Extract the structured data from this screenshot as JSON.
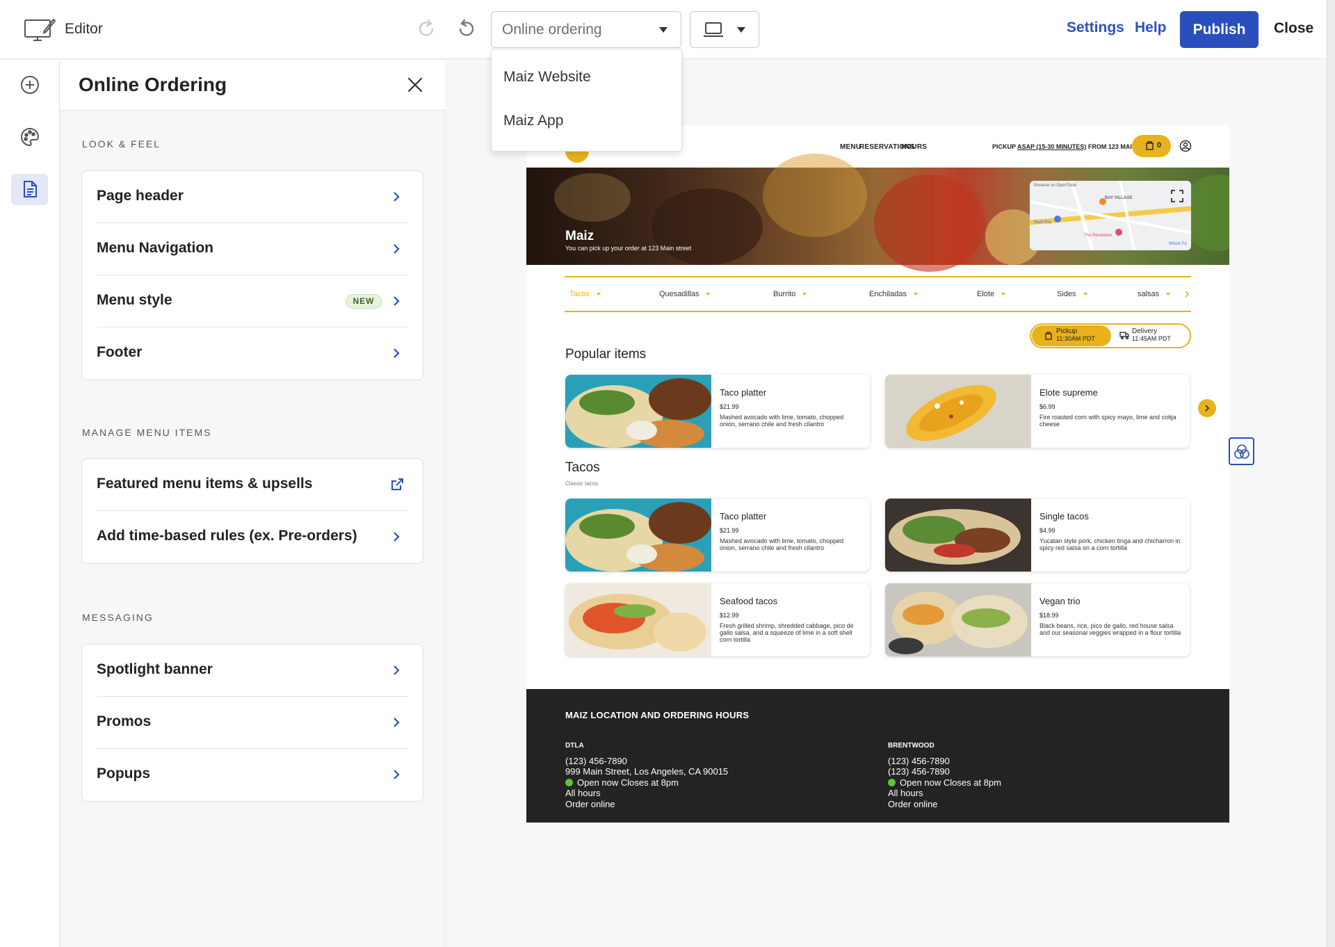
{
  "topbar": {
    "editor_label": "Editor",
    "page_select": {
      "value": "Online ordering",
      "options": [
        "Maiz Website",
        "Maiz App"
      ]
    },
    "device_icon": "laptop-icon",
    "settings": "Settings",
    "help": "Help",
    "publish": "Publish",
    "close": "Close"
  },
  "rail": {
    "icons": [
      "add-icon",
      "palette-icon",
      "page-icon"
    ]
  },
  "panel": {
    "title": "Online Ordering",
    "sections": [
      {
        "label": "LOOK & FEEL",
        "rows": [
          "Page header",
          "Menu Navigation",
          "Menu style",
          "Footer"
        ],
        "badge": "NEW"
      },
      {
        "label": "MANAGE MENU ITEMS",
        "rows": [
          "Featured menu items & upsells",
          "Add time-based rules (ex. Pre-orders)"
        ]
      },
      {
        "label": "MESSAGING",
        "rows": [
          "Spotlight banner",
          "Promos",
          "Popups"
        ]
      }
    ]
  },
  "preview": {
    "nav": [
      "MENU",
      "RESERVATIONS",
      "HOURS"
    ],
    "pickup": {
      "prefix": "PICKUP",
      "time": "ASAP (15-30 MINUTES)",
      "suffix": "FROM 123 MAIN STREET"
    },
    "cart_count": "0",
    "hero": {
      "title": "Maiz",
      "subtitle": "You can pick up your order at 123 Main street"
    },
    "map": {
      "top_label": "Reserve on OpenTable",
      "l1": "BAY VILLAGE",
      "l2": "Back Bay",
      "l3": "The Revolution",
      "l4": "Whole Fo"
    },
    "categories": [
      "Tacos",
      "Quesadillas",
      "Burrito",
      "Enchiladas",
      "Elote",
      "Sides",
      "salsas"
    ],
    "toggle": {
      "pickup": "Pickup",
      "pickup_time": "11:30AM PDT",
      "delivery": "Delivery",
      "delivery_time": "11:45AM PDT"
    },
    "popular_title": "Popular items",
    "popular": [
      {
        "name": "Taco platter",
        "price": "$21.99",
        "desc": "Mashed avocado with lime, tomato, chopped onion, serrano chile and fresh cilantro"
      },
      {
        "name": "Elote supreme",
        "price": "$6.99",
        "desc": "Fire roasted corn with spicy mayo, lime and cotija cheese"
      }
    ],
    "tacos_title": "Tacos",
    "tacos_sub": "Classic tacos",
    "tacos": [
      {
        "name": "Taco platter",
        "price": "$21.99",
        "desc": "Mashed avocado with lime, tomato, chopped onion, serrano chile and fresh cilantro"
      },
      {
        "name": "Single tacos",
        "price": "$4.99",
        "desc": "Yucatan style pork, chicken tinga and chicharron in spicy red salsa on a corn tortilla"
      },
      {
        "name": "Seafood tacos",
        "price": "$12.99",
        "desc": "Fresh grilled shrimp, shredded cabbage, pico de gallo salsa, and a squeeze of lime in a soft shell corn tortilla"
      },
      {
        "name": "Vegan trio",
        "price": "$18.99",
        "desc": "Black beans, rice, pico de gallo, red house salsa and our seasonal veggies wrapped in a flour tortilla"
      }
    ],
    "footer": {
      "title": "MAIZ LOCATION AND ORDERING HOURS",
      "locations": [
        {
          "name": "DTLA",
          "phone": "(123) 456-7890",
          "line2": "999 Main Street, Los Angeles, CA 90015",
          "open": "Open now Closes at 8pm",
          "hours": "All hours",
          "order": "Order online"
        },
        {
          "name": "BRENTWOOD",
          "phone": "(123) 456-7890",
          "line2": "(123) 456-7890",
          "open": "Open now Closes at 8pm",
          "hours": "All hours",
          "order": "Order online"
        }
      ]
    }
  },
  "colors": {
    "accent": "#2a4ebd",
    "brand_yellow": "#e8b21c",
    "footer_bg": "#232323",
    "open_green": "#5cc33a"
  }
}
